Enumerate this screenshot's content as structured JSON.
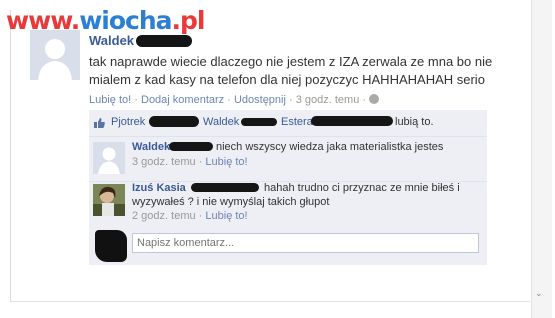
{
  "watermark": {
    "part1": "www.",
    "part2": "wiocha",
    "part3": ".pl"
  },
  "post": {
    "author": "Waldek",
    "text": "tak naprawde wiecie dlaczego nie jestem z IZA zerwala ze mna bo nie mialem z kad kasy na telefon dla niej pozyczyc HAHHAHAHAH serio",
    "actions": {
      "like": "Lubię to!",
      "comment": "Dodaj komentarz",
      "share": "Udostępnij",
      "time": "3 godz. temu",
      "sep": "·"
    }
  },
  "likes": {
    "names": [
      "Pjotrek",
      "Waldek",
      "Estera"
    ],
    "suffix": "lubią to."
  },
  "comments": [
    {
      "author": "Waldek",
      "text": "niech wszyscy wiedza jaka materialistka jestes",
      "time": "3 godz. temu",
      "like": "Lubię to!"
    },
    {
      "author": "Izuś Kasia",
      "text_line1": "hahah trudno ci przyznac ze mnie biłeś i",
      "text_line2": "wyzywałeś ? i nie wymyślaj takich głupot",
      "time": "2 godz. temu",
      "like": "Lubię to!"
    }
  ],
  "comment_box": {
    "placeholder": "Napisz komentarz..."
  },
  "scroll": {
    "arrow": "⌄"
  },
  "icons": {
    "like": "thumb-up-icon",
    "privacy": "globe-icon"
  }
}
